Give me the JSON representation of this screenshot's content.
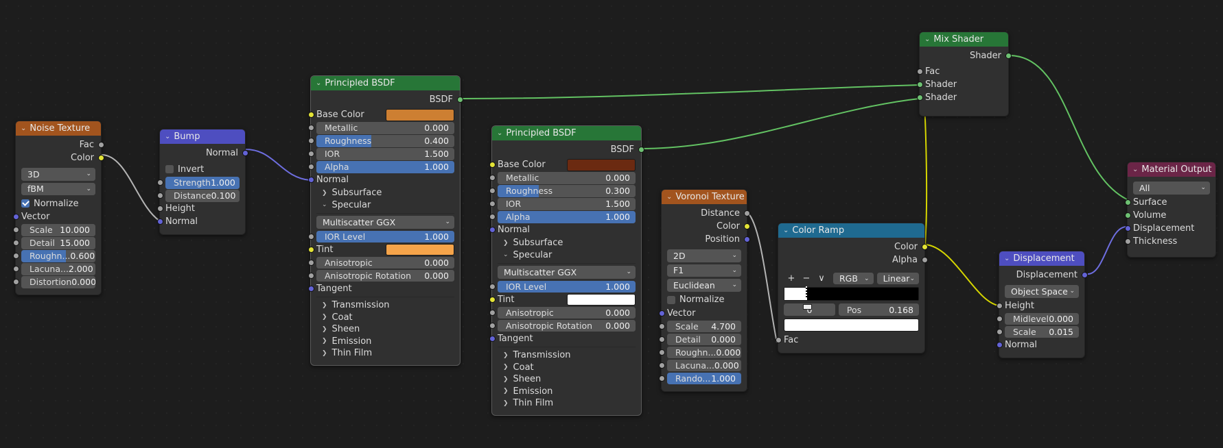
{
  "editor": {
    "background_color": "#1d1d1d",
    "title": "Blender Shader Node Editor"
  },
  "colors": {
    "texture_header": "#a2541e",
    "shader_header": "#277637",
    "vector_header": "#4e4ec0",
    "converter_header": "#1f6a90",
    "output_header": "#6b2547",
    "slider_fill": "#4772b3",
    "socket_shader": "#6ec173",
    "socket_color": "#e3e337",
    "socket_vector": "#6363d6",
    "socket_float": "#a1a1a1",
    "wire_shader": "#63c363",
    "wire_color": "#d6d600",
    "wire_vector": "#6e6ee0",
    "wire_float": "#b4b4b4"
  },
  "nodes": {
    "noise_texture": {
      "title": "Noise Texture",
      "outputs": [
        {
          "label": "Fac",
          "type": "float"
        },
        {
          "label": "Color",
          "type": "color"
        }
      ],
      "dimension": "3D",
      "noise_type": "fBM",
      "normalize_label": "Normalize",
      "normalize_checked": true,
      "vector_label": "Vector",
      "props": [
        {
          "label": "Scale",
          "value": "10.000",
          "slider": false
        },
        {
          "label": "Detail",
          "value": "15.000",
          "slider": false
        },
        {
          "label": "Roughn...",
          "value": "0.600",
          "slider": true,
          "fill": 60
        },
        {
          "label": "Lacuna...",
          "value": "2.000",
          "slider": false
        },
        {
          "label": "Distortion",
          "value": "0.000",
          "slider": false
        }
      ]
    },
    "bump": {
      "title": "Bump",
      "output_label": "Normal",
      "invert_label": "Invert",
      "invert_checked": false,
      "props": [
        {
          "label": "Strength",
          "value": "1.000",
          "slider": true,
          "fill": 100
        },
        {
          "label": "Distance",
          "value": "0.100",
          "slider": false
        }
      ],
      "inputs": [
        {
          "label": "Height",
          "type": "float"
        },
        {
          "label": "Normal",
          "type": "vector"
        }
      ]
    },
    "principled_bsdf_1": {
      "title": "Principled BSDF",
      "output_label": "BSDF",
      "base_color_label": "Base Color",
      "base_color": "#cd7f32",
      "props": [
        {
          "label": "Metallic",
          "value": "0.000",
          "slider": false
        },
        {
          "label": "Roughness",
          "value": "0.400",
          "slider": true,
          "fill": 40
        },
        {
          "label": "IOR",
          "value": "1.500",
          "slider": false
        },
        {
          "label": "Alpha",
          "value": "1.000",
          "slider": true,
          "fill": 100
        }
      ],
      "normal_label": "Normal",
      "subsurface_label": "Subsurface",
      "specular_label": "Specular",
      "distribution": "Multiscatter GGX",
      "ior_level": {
        "label": "IOR Level",
        "value": "1.000",
        "fill": 100
      },
      "tint_label": "Tint",
      "tint_color": "#f5a44a",
      "aniso": [
        {
          "label": "Anisotropic",
          "value": "0.000"
        },
        {
          "label": "Anisotropic Rotation",
          "value": "0.000"
        }
      ],
      "tangent_label": "Tangent",
      "panels": [
        "Transmission",
        "Coat",
        "Sheen",
        "Emission",
        "Thin Film"
      ]
    },
    "principled_bsdf_2": {
      "title": "Principled BSDF",
      "output_label": "BSDF",
      "base_color_label": "Base Color",
      "base_color": "#6b2a11",
      "props": [
        {
          "label": "Metallic",
          "value": "0.000",
          "slider": false
        },
        {
          "label": "Roughness",
          "value": "0.300",
          "slider": true,
          "fill": 30
        },
        {
          "label": "IOR",
          "value": "1.500",
          "slider": false
        },
        {
          "label": "Alpha",
          "value": "1.000",
          "slider": true,
          "fill": 100
        }
      ],
      "normal_label": "Normal",
      "subsurface_label": "Subsurface",
      "specular_label": "Specular",
      "distribution": "Multiscatter GGX",
      "ior_level": {
        "label": "IOR Level",
        "value": "1.000",
        "fill": 100
      },
      "tint_label": "Tint",
      "tint_color": "#ffffff",
      "aniso": [
        {
          "label": "Anisotropic",
          "value": "0.000"
        },
        {
          "label": "Anisotropic Rotation",
          "value": "0.000"
        }
      ],
      "tangent_label": "Tangent",
      "panels": [
        "Transmission",
        "Coat",
        "Sheen",
        "Emission",
        "Thin Film"
      ]
    },
    "voronoi_texture": {
      "title": "Voronoi Texture",
      "outputs": [
        {
          "label": "Distance",
          "type": "float"
        },
        {
          "label": "Color",
          "type": "color"
        },
        {
          "label": "Position",
          "type": "vector"
        }
      ],
      "dimension": "2D",
      "feature": "F1",
      "metric": "Euclidean",
      "normalize_label": "Normalize",
      "normalize_checked": false,
      "vector_label": "Vector",
      "props": [
        {
          "label": "Scale",
          "value": "4.700",
          "slider": false
        },
        {
          "label": "Detail",
          "value": "0.000",
          "slider": false
        },
        {
          "label": "Roughn...",
          "value": "0.000",
          "slider": false
        },
        {
          "label": "Lacuna...",
          "value": "0.000",
          "slider": false
        },
        {
          "label": "Rando...",
          "value": "1.000",
          "slider": true,
          "fill": 100
        }
      ]
    },
    "color_ramp": {
      "title": "Color Ramp",
      "outputs": [
        {
          "label": "Color",
          "type": "color"
        },
        {
          "label": "Alpha",
          "type": "float"
        }
      ],
      "tools": {
        "add": "+",
        "remove": "−",
        "menu": "∨"
      },
      "color_mode": "RGB",
      "interpolation": "Linear",
      "stop_index": "0",
      "pos_label": "Pos",
      "pos_value": "0.168",
      "selected_color": "#ffffff",
      "ramp_stop_position": 16.8,
      "input_label": "Fac"
    },
    "mix_shader": {
      "title": "Mix Shader",
      "output_label": "Shader",
      "inputs": [
        {
          "label": "Fac",
          "type": "float"
        },
        {
          "label": "Shader",
          "type": "shader"
        },
        {
          "label": "Shader",
          "type": "shader"
        }
      ]
    },
    "displacement": {
      "title": "Displacement",
      "output_label": "Displacement",
      "space": "Object Space",
      "height_label": "Height",
      "props": [
        {
          "label": "Midlevel",
          "value": "0.000"
        },
        {
          "label": "Scale",
          "value": "0.015"
        }
      ],
      "normal_label": "Normal"
    },
    "material_output": {
      "title": "Material Output",
      "target": "All",
      "inputs": [
        {
          "label": "Surface",
          "type": "shader"
        },
        {
          "label": "Volume",
          "type": "shader"
        },
        {
          "label": "Displacement",
          "type": "vector"
        },
        {
          "label": "Thickness",
          "type": "float"
        }
      ]
    }
  }
}
